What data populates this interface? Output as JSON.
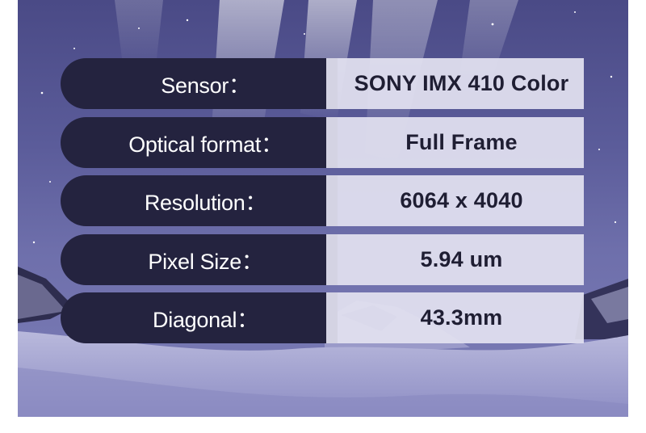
{
  "specs": [
    {
      "label": "Sensor：",
      "value": "SONY IMX 410 Color"
    },
    {
      "label": "Optical format：",
      "value": "Full Frame"
    },
    {
      "label": "Resolution：",
      "value": "6064 x 4040"
    },
    {
      "label": "Pixel Size：",
      "value": "5.94 um"
    },
    {
      "label": "Diagonal：",
      "value": "43.3mm"
    }
  ],
  "colors": {
    "label_bg": "#24233f",
    "value_bg": "#e2e1f0",
    "sky": "#5b5c9a"
  }
}
